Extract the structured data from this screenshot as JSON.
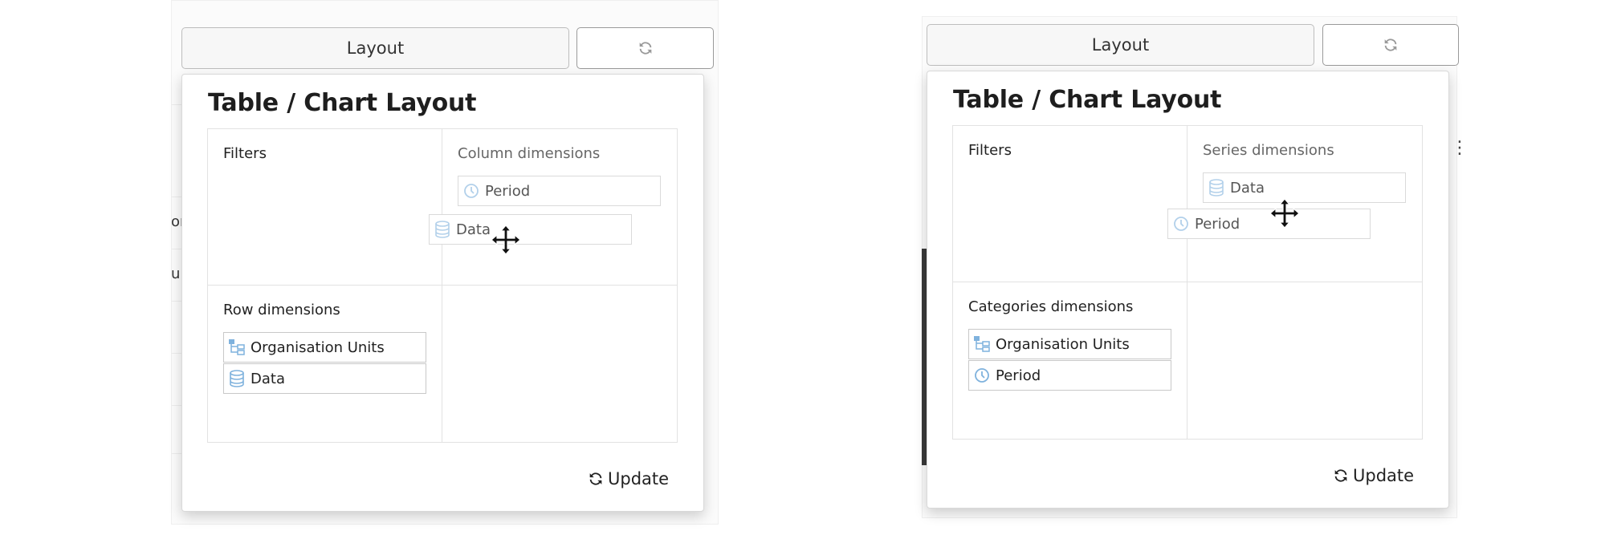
{
  "panels": [
    {
      "layout_button_label": "Layout",
      "popup_title": "Table / Chart Layout",
      "filters_label": "Filters",
      "top_right_label": "Column dimensions",
      "top_right_chips": [
        {
          "label": "Period",
          "icon": "period-icon"
        }
      ],
      "dragging_chip": {
        "label": "Data",
        "icon": "data-icon"
      },
      "bottom_left_label": "Row dimensions",
      "bottom_left_chips": [
        {
          "label": "Organisation Units",
          "icon": "org-units-icon"
        },
        {
          "label": "Data",
          "icon": "data-icon"
        }
      ],
      "update_label": "Update",
      "background_fragments": [
        "on",
        "un"
      ]
    },
    {
      "layout_button_label": "Layout",
      "popup_title": "Table / Chart Layout",
      "filters_label": "Filters",
      "top_right_label": "Series dimensions",
      "top_right_chips": [
        {
          "label": "Data",
          "icon": "data-icon"
        }
      ],
      "dragging_chip": {
        "label": "Period",
        "icon": "period-icon"
      },
      "bottom_left_label": "Categories dimensions",
      "bottom_left_chips": [
        {
          "label": "Organisation Units",
          "icon": "org-units-icon"
        },
        {
          "label": "Period",
          "icon": "period-icon"
        }
      ],
      "update_label": "Update",
      "background_fragments": []
    }
  ],
  "colors": {
    "icon_blue": "#7fb2dd",
    "border": "#c8c8c8"
  }
}
